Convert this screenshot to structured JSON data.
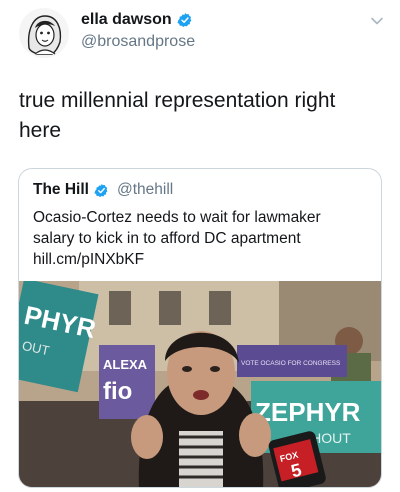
{
  "tweet": {
    "display_name": "ella dawson",
    "handle": "@brosandprose",
    "text": "true millennial representation right here"
  },
  "quoted_tweet": {
    "display_name": "The Hill",
    "handle": "@thehill",
    "text": "Ocasio-Cortez needs to wait for lawmaker salary to kick in to afford DC apartment",
    "link": "hill.cm/pINXbKF",
    "media": {
      "sign_left": "PHYR",
      "sign_left_sub": "OUT",
      "sign_purple": "ALEXA",
      "sign_purple_sub": "fio",
      "sign_top_right": "VOTE OCASIO FOR CONGRESS",
      "sign_right": "ZEPHYR",
      "sign_right_sub": "CHOUT",
      "mic_logo": "FOX",
      "mic_number": "5"
    }
  },
  "colors": {
    "verified": "#1da1f2",
    "secondary_text": "#657786",
    "border": "#ccd6dd"
  },
  "icons": [
    "verified-badge-icon",
    "chevron-down-icon"
  ]
}
